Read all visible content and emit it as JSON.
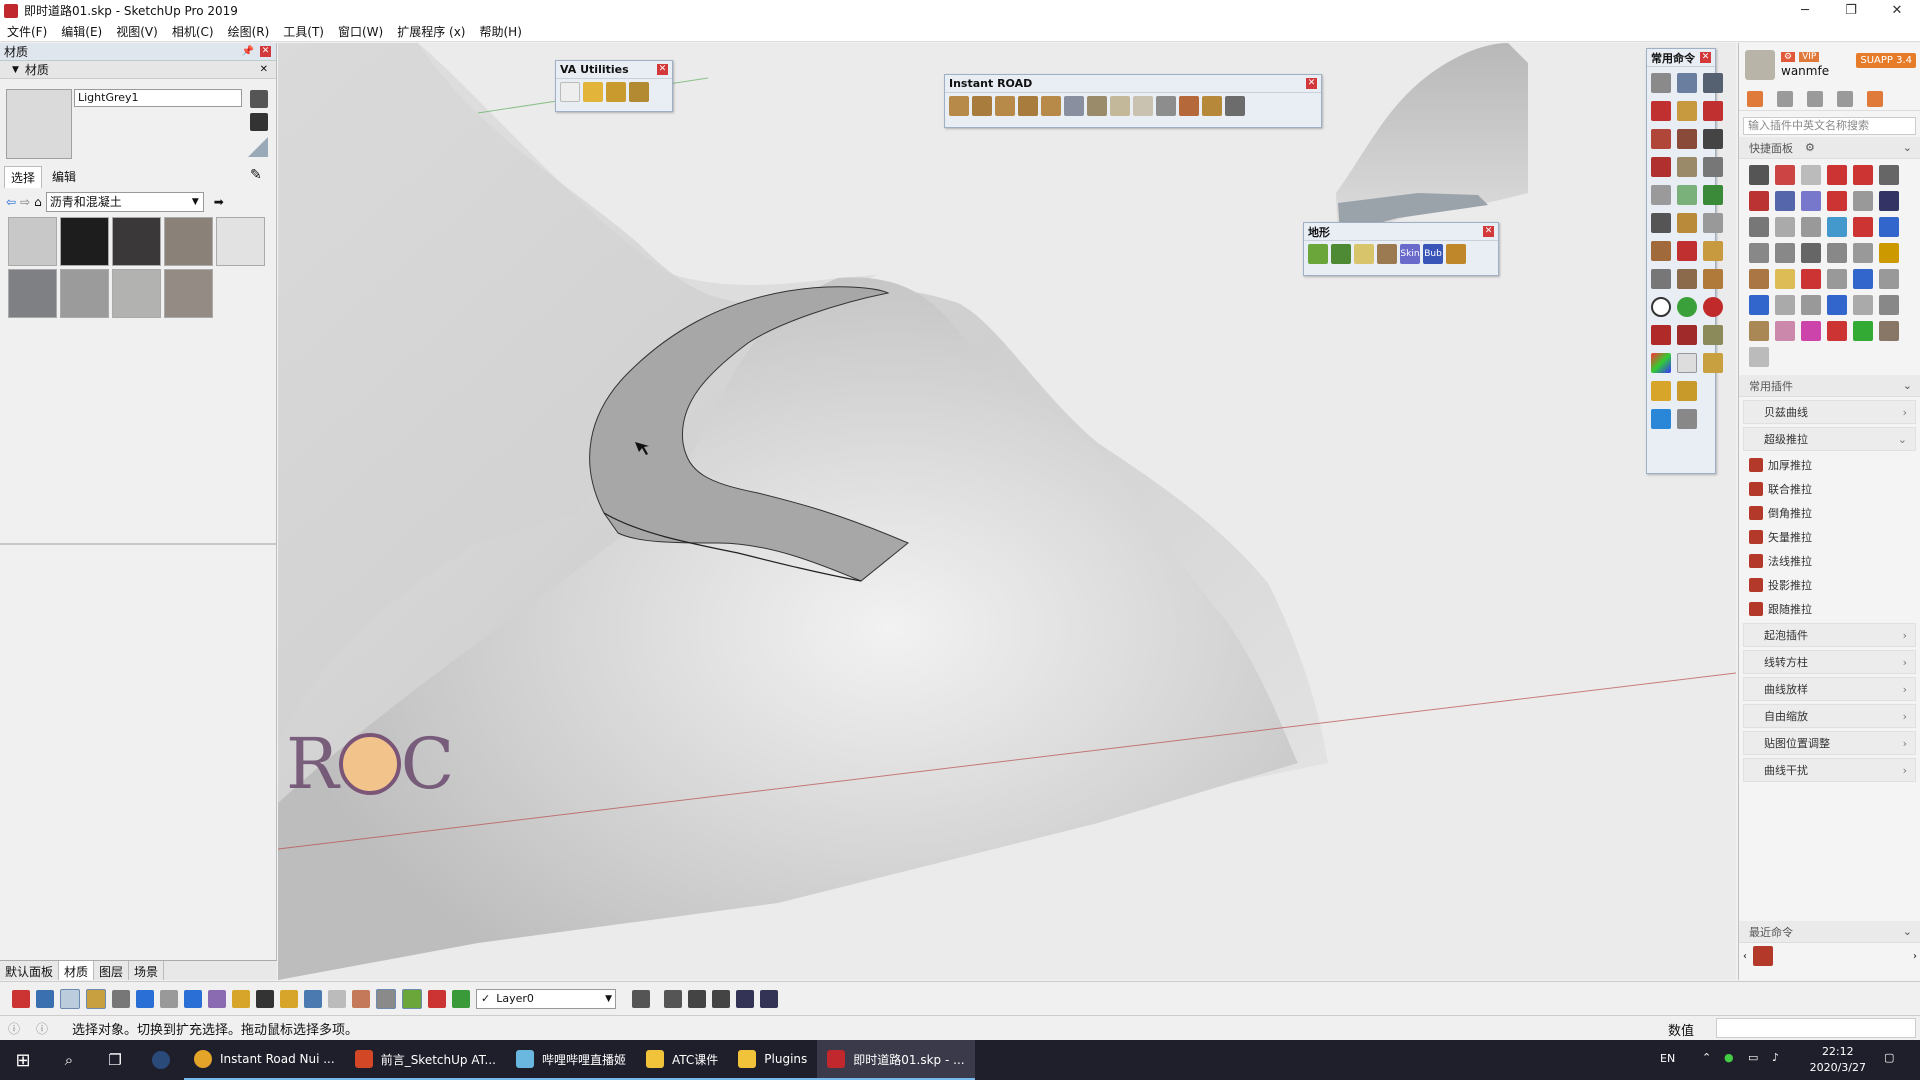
{
  "window": {
    "title": "即时道路01.skp - SketchUp Pro 2019",
    "min": "─",
    "max": "❐",
    "close": "✕"
  },
  "menu": [
    "文件(F)",
    "编辑(E)",
    "视图(V)",
    "相机(C)",
    "绘图(R)",
    "工具(T)",
    "窗口(W)",
    "扩展程序 (x)",
    "帮助(H)"
  ],
  "left_panel": {
    "title": "材质",
    "section": "材质",
    "material_name": "LightGrey1",
    "tabs": [
      "选择",
      "编辑"
    ],
    "library": "沥青和混凝土",
    "swatches": [
      "#c8c8c8",
      "#1d1d1d",
      "#3a3838",
      "#8a8178",
      "#e2e2e2",
      "#7e8084",
      "#9b9b9b",
      "#b2b2b0",
      "#948c84"
    ],
    "bottom_tabs": [
      "默认面板",
      "材质",
      "图层",
      "场景"
    ]
  },
  "va_utilities": {
    "title": "VA Utilities"
  },
  "instant_road": {
    "title": "Instant ROAD"
  },
  "terrain": {
    "title": "地形",
    "skin_label": "Skin",
    "bub_label": "Bub"
  },
  "common_cmd": {
    "title": "常用命令"
  },
  "right_sidebar": {
    "username": "wanmfe",
    "badge": "SUAPP 3.4",
    "vip": "VIP",
    "search_placeholder": "输入插件中英文名称搜索",
    "quick_panel": "快捷面板",
    "common_plugins": "常用插件",
    "groups": [
      "贝兹曲线",
      "超级推拉"
    ],
    "push_items": [
      "加厚推拉",
      "联合推拉",
      "倒角推拉",
      "矢量推拉",
      "法线推拉",
      "投影推拉",
      "跟随推拉"
    ],
    "more_groups": [
      "起泡插件",
      "线转方柱",
      "曲线放样",
      "自由缩放",
      "贴图位置调整",
      "曲线干扰"
    ],
    "recent": "最近命令"
  },
  "layer": {
    "name": "Layer0",
    "check": "✓"
  },
  "status": {
    "text": "选择对象。切换到扩充选择。拖动鼠标选择多项。",
    "value_label": "数值"
  },
  "watermark": "ROC",
  "taskbar": {
    "items": [
      "Instant Road Nui ...",
      "前言_SketchUp AT...",
      "哔哩哔哩直播姬",
      "ATC课件",
      "Plugins",
      "即时道路01.skp - ..."
    ],
    "ime": "EN",
    "time": "22:12",
    "date": "2020/3/27"
  },
  "colors": {
    "accent": "#0078d7",
    "close": "#d3383b",
    "viewport_bg": "#e9e9e9"
  }
}
